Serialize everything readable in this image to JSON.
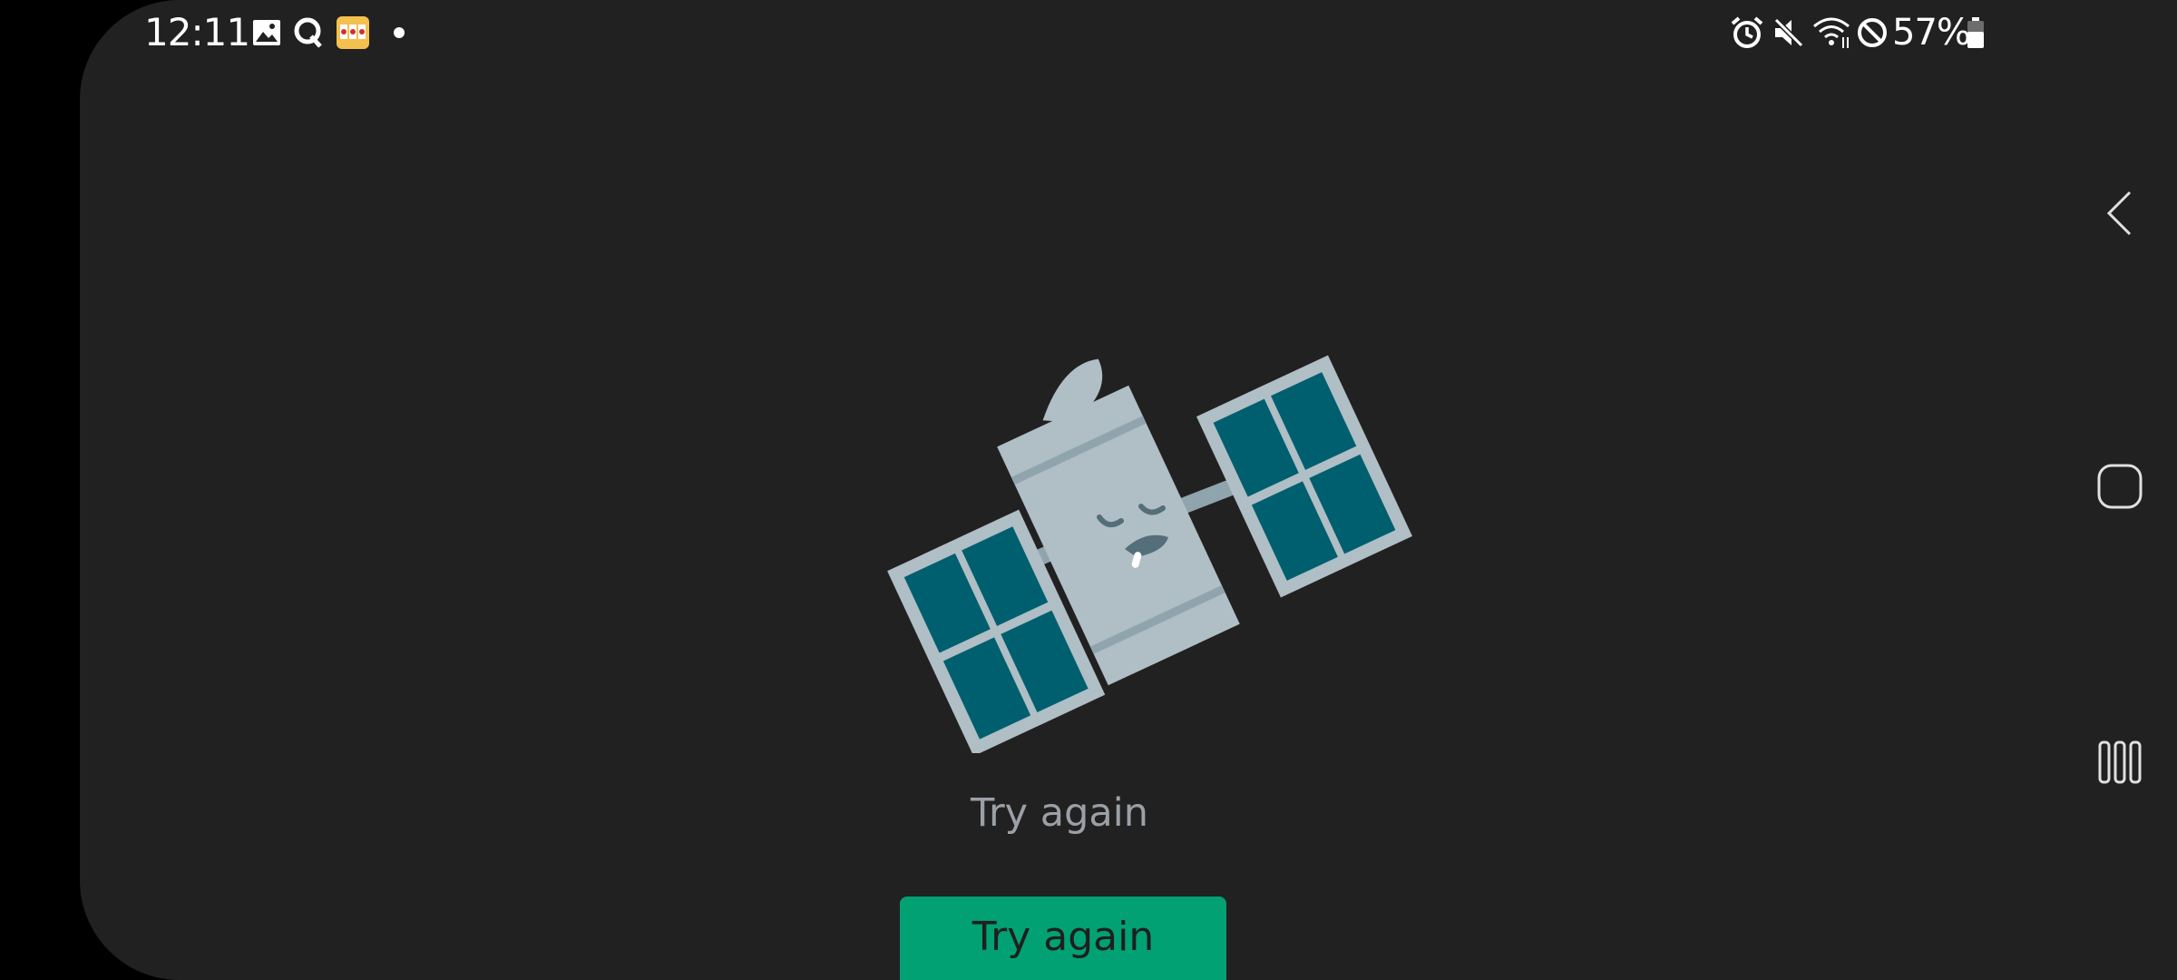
{
  "status_bar": {
    "time": "12:11",
    "battery_percent": "57%",
    "left_icons": [
      "gallery-icon",
      "q-app-icon",
      "slot-game-icon",
      "notification-dot-icon"
    ],
    "right_icons": [
      "alarm-icon",
      "mute-icon",
      "wifi-icon",
      "do-not-disturb-icon",
      "battery-icon"
    ]
  },
  "content": {
    "illustration": "sleeping-satellite-illustration",
    "message": "Try again",
    "button_label": "Try again"
  },
  "colors": {
    "background": "#212121",
    "button": "#01a173",
    "panel": "#005f6f",
    "satellite_body": "#b0bec5",
    "message_text": "#9aa0a6"
  },
  "navigation_bar": {
    "buttons": [
      "back-icon",
      "home-icon",
      "recent-apps-icon"
    ]
  }
}
